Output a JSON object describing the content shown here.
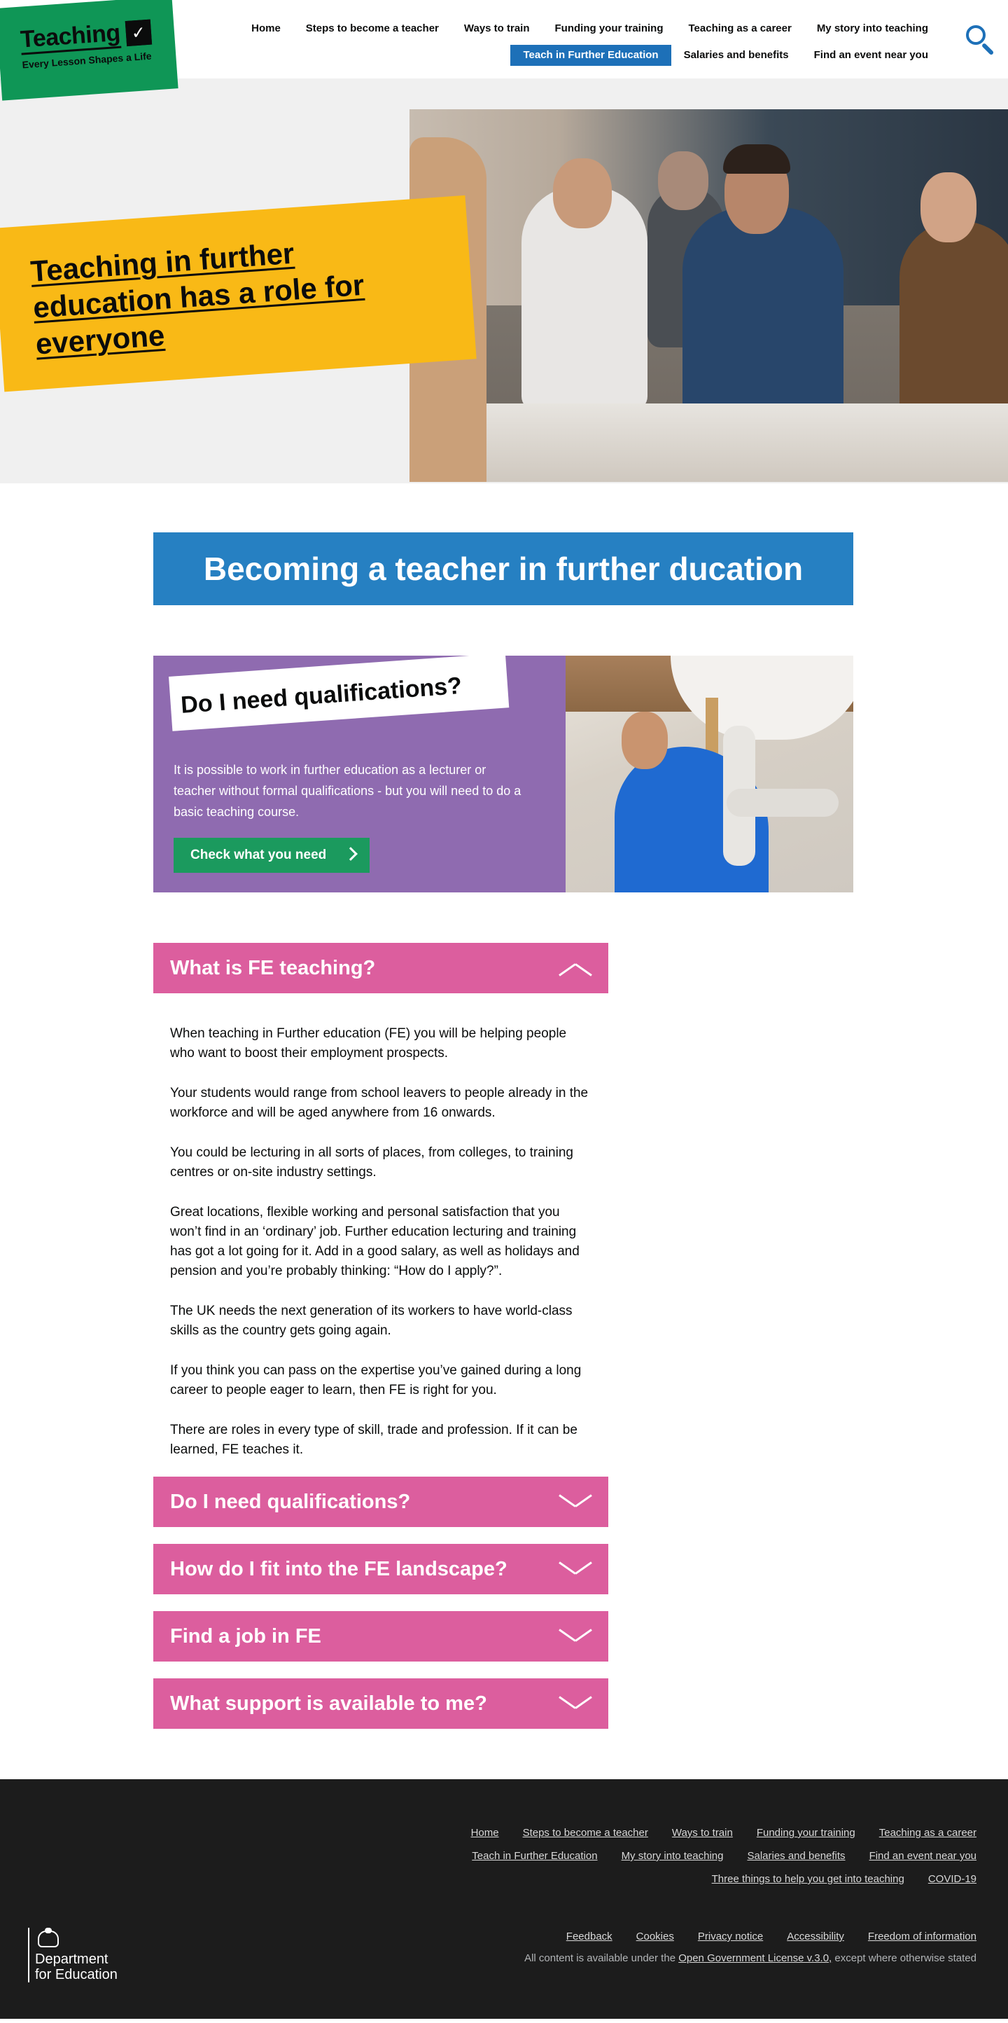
{
  "header": {
    "logo_word": "Teaching",
    "logo_tagline": "Every Lesson Shapes a Life",
    "nav_row1": [
      "Home",
      "Steps to become a teacher",
      "Ways to train",
      "Funding your training",
      "Teaching as a career",
      "My story into teaching"
    ],
    "nav_row2": [
      "Teach in Further Education",
      "Salaries and benefits",
      "Find an event near you"
    ],
    "active_nav": "Teach in Further Education",
    "search_icon": "search-icon"
  },
  "hero": {
    "title": "Teaching in further education has a role for everyone",
    "banner_color": "#f9b916"
  },
  "page_title": "Becoming a teacher in further ducation",
  "promo": {
    "heading": "Do I need qualifications?",
    "body": "It is possible to work in further education as a lecturer or teacher without formal qualifications - but you will need to do a basic teaching course.",
    "button_label": "Check what you need"
  },
  "accordion": {
    "items": [
      {
        "title": "What is FE teaching?",
        "expanded": true
      },
      {
        "title": "Do I need qualifications?",
        "expanded": false
      },
      {
        "title": "How do I fit into the FE landscape?",
        "expanded": false
      },
      {
        "title": "Find a job in FE",
        "expanded": false
      },
      {
        "title": "What support is available to me?",
        "expanded": false
      }
    ],
    "open_paragraphs": [
      "When teaching in Further education (FE) you will be helping people who want to boost their employment prospects.",
      "Your students would range from school leavers to people already in the workforce and will be aged anywhere from 16 onwards.",
      "You could be lecturing in all sorts of places, from colleges, to training centres or on-site industry settings.",
      "Great locations, flexible working and personal satisfaction that you won’t find in an ‘ordinary’ job. Further education lecturing and training has got a lot going for it. Add in a good salary, as well as holidays and pension and you’re probably thinking: “How do I apply?”.",
      "The UK needs the next generation of its workers to have world-class skills as the country gets going again.",
      "If you think you can pass on the expertise you’ve gained during a long career to people eager to learn, then FE is right for you.",
      "There are roles in every type of skill, trade and profession. If it can be learned, FE teaches it."
    ],
    "color": "#dc5e9e"
  },
  "footer": {
    "links_row1": [
      "Home",
      "Steps to become a teacher",
      "Ways to train",
      "Funding your training",
      "Teaching as a career"
    ],
    "links_row2": [
      "Teach in Further Education",
      "My story into teaching",
      "Salaries and benefits",
      "Find an event near you"
    ],
    "links_row3": [
      "Three things to help you get into teaching",
      "COVID-19"
    ],
    "dfe_line1": "Department",
    "dfe_line2": "for Education",
    "legal_links": [
      "Feedback",
      "Cookies",
      "Privacy notice",
      "Accessibility",
      "Freedom of information"
    ],
    "license_prefix": "All content is available under the ",
    "license_link": "Open Government License v.3.0,",
    "license_suffix": " except where otherwise stated"
  }
}
